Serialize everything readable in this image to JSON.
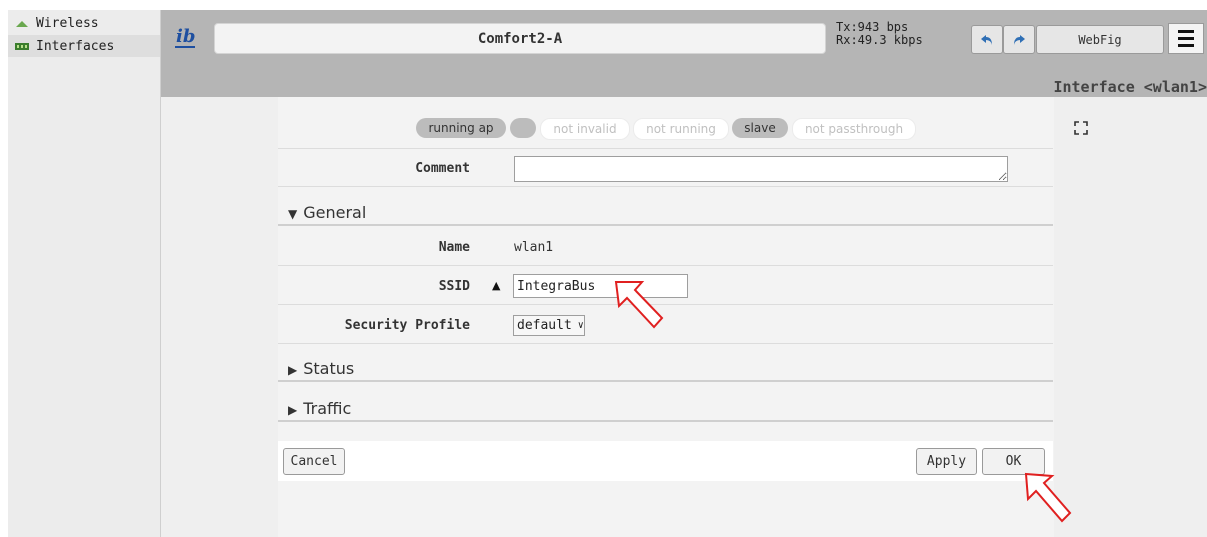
{
  "sidebar": {
    "items": [
      {
        "label": "Wireless"
      },
      {
        "label": "Interfaces"
      }
    ]
  },
  "header": {
    "identity": "Comfort2-A",
    "tx": "Tx:943 bps",
    "rx": "Rx:49.3 kbps",
    "webfig_label": "WebFig",
    "window_title": "Interface <wlan1>"
  },
  "flags": [
    "running ap",
    "",
    "not invalid",
    "not running",
    "slave",
    "not passthrough"
  ],
  "form": {
    "comment_label": "Comment",
    "comment_value": "",
    "general_label": "General",
    "name_label": "Name",
    "name_value": "wlan1",
    "ssid_label": "SSID",
    "ssid_value": "IntegraBus",
    "security_label": "Security Profile",
    "security_value": "default",
    "status_label": "Status",
    "traffic_label": "Traffic"
  },
  "buttons": {
    "cancel": "Cancel",
    "apply": "Apply",
    "ok": "OK"
  },
  "colors": {
    "header_bg": "#b5b5b5",
    "annotation": "#e02020"
  }
}
